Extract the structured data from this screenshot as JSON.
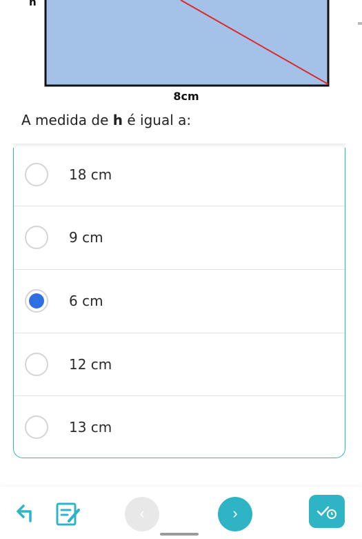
{
  "figure": {
    "height_label": "h",
    "base_label": "8cm",
    "fill_color": "#a4c2e8",
    "diagonal_color": "#e0262c"
  },
  "question": {
    "prefix": "A medida de ",
    "variable": "h",
    "suffix": " é igual a:"
  },
  "options": [
    {
      "label": "18 cm",
      "selected": false
    },
    {
      "label": "9 cm",
      "selected": false
    },
    {
      "label": "6 cm",
      "selected": true
    },
    {
      "label": "12 cm",
      "selected": false
    },
    {
      "label": "13 cm",
      "selected": false
    }
  ],
  "toolbar": {
    "back_icon": "back-arrow-icon",
    "notes_icon": "notes-edit-icon",
    "prev_label": "‹",
    "next_label": "›",
    "finish_icon": "check-timer-icon"
  },
  "colors": {
    "accent": "#2fb4c5",
    "selected_radio": "#2f6fe4"
  }
}
